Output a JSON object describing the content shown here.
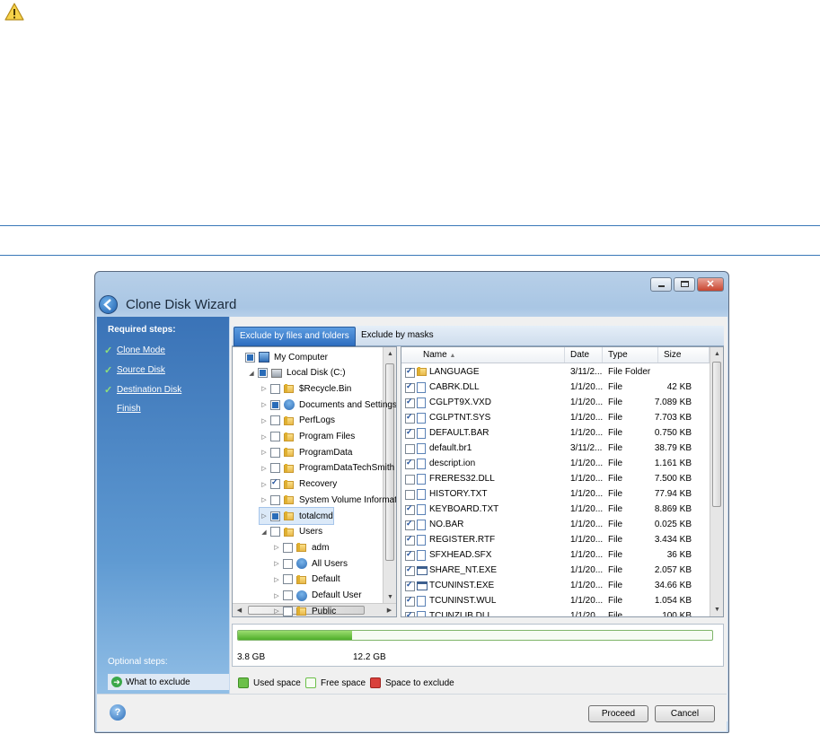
{
  "window": {
    "title": "Clone Disk Wizard",
    "controls": {
      "minimize": "minimize-icon",
      "maximize": "maximize-icon",
      "close": "close-icon"
    }
  },
  "sidebar": {
    "required_heading": "Required steps:",
    "steps": [
      {
        "label": "Clone Mode",
        "done": true
      },
      {
        "label": "Source Disk",
        "done": true
      },
      {
        "label": "Destination Disk",
        "done": true
      },
      {
        "label": "Finish",
        "done": false
      }
    ],
    "optional_heading": "Optional steps:",
    "optional_steps": [
      {
        "label": "What to exclude",
        "selected": true
      }
    ]
  },
  "tabs": [
    {
      "label": "Exclude by files and folders",
      "active": true
    },
    {
      "label": "Exclude by masks",
      "active": false
    }
  ],
  "tree": [
    {
      "label": "My Computer",
      "icon": "computer",
      "check": "part",
      "expander": ""
    },
    {
      "label": "Local Disk (C:)",
      "icon": "disk",
      "check": "part",
      "expander": "◢"
    },
    {
      "label": "$Recycle.Bin",
      "icon": "folder",
      "check": "off",
      "expander": "▷"
    },
    {
      "label": "Documents and Settings",
      "icon": "user",
      "check": "part",
      "expander": "▷"
    },
    {
      "label": "PerfLogs",
      "icon": "folder",
      "check": "off",
      "expander": "▷"
    },
    {
      "label": "Program Files",
      "icon": "folder",
      "check": "off",
      "expander": "▷"
    },
    {
      "label": "ProgramData",
      "icon": "folder",
      "check": "off",
      "expander": "▷"
    },
    {
      "label": "ProgramDataTechSmith",
      "icon": "folder",
      "check": "off",
      "expander": "▷"
    },
    {
      "label": "Recovery",
      "icon": "folder",
      "check": "on",
      "expander": "▷"
    },
    {
      "label": "System Volume Information",
      "icon": "folder",
      "check": "off",
      "expander": "▷"
    },
    {
      "label": "totalcmd",
      "icon": "folder",
      "check": "part",
      "expander": "▷",
      "selected": true
    },
    {
      "label": "Users",
      "icon": "folder",
      "check": "off",
      "expander": "◢"
    },
    {
      "label": "adm",
      "icon": "folder",
      "check": "off",
      "expander": "▷"
    },
    {
      "label": "All Users",
      "icon": "user",
      "check": "off",
      "expander": "▷"
    },
    {
      "label": "Default",
      "icon": "folder",
      "check": "off",
      "expander": "▷"
    },
    {
      "label": "Default User",
      "icon": "user",
      "check": "off",
      "expander": "▷"
    },
    {
      "label": "Public",
      "icon": "folder",
      "check": "off",
      "expander": "▷"
    }
  ],
  "list": {
    "columns": [
      "Name",
      "Date",
      "Type",
      "Size"
    ],
    "rows": [
      {
        "name": "LANGUAGE",
        "date": "3/11/2...",
        "type": "File Folder",
        "size": "",
        "checked": true,
        "icon": "folder"
      },
      {
        "name": "CABRK.DLL",
        "date": "1/1/20...",
        "type": "File",
        "size": "42 KB",
        "checked": true,
        "icon": "file"
      },
      {
        "name": "CGLPT9X.VXD",
        "date": "1/1/20...",
        "type": "File",
        "size": "7.089 KB",
        "checked": true,
        "icon": "file"
      },
      {
        "name": "CGLPTNT.SYS",
        "date": "1/1/20...",
        "type": "File",
        "size": "7.703 KB",
        "checked": true,
        "icon": "file"
      },
      {
        "name": "DEFAULT.BAR",
        "date": "1/1/20...",
        "type": "File",
        "size": "0.750 KB",
        "checked": true,
        "icon": "file"
      },
      {
        "name": "default.br1",
        "date": "3/11/2...",
        "type": "File",
        "size": "38.79 KB",
        "checked": false,
        "icon": "file"
      },
      {
        "name": "descript.ion",
        "date": "1/1/20...",
        "type": "File",
        "size": "1.161 KB",
        "checked": true,
        "icon": "file"
      },
      {
        "name": "FRERES32.DLL",
        "date": "1/1/20...",
        "type": "File",
        "size": "7.500 KB",
        "checked": false,
        "icon": "file"
      },
      {
        "name": "HISTORY.TXT",
        "date": "1/1/20...",
        "type": "File",
        "size": "77.94 KB",
        "checked": false,
        "icon": "file"
      },
      {
        "name": "KEYBOARD.TXT",
        "date": "1/1/20...",
        "type": "File",
        "size": "8.869 KB",
        "checked": true,
        "icon": "file"
      },
      {
        "name": "NO.BAR",
        "date": "1/1/20...",
        "type": "File",
        "size": "0.025 KB",
        "checked": true,
        "icon": "file"
      },
      {
        "name": "REGISTER.RTF",
        "date": "1/1/20...",
        "type": "File",
        "size": "3.434 KB",
        "checked": true,
        "icon": "file"
      },
      {
        "name": "SFXHEAD.SFX",
        "date": "1/1/20...",
        "type": "File",
        "size": "36 KB",
        "checked": true,
        "icon": "file"
      },
      {
        "name": "SHARE_NT.EXE",
        "date": "1/1/20...",
        "type": "File",
        "size": "2.057 KB",
        "checked": true,
        "icon": "exe"
      },
      {
        "name": "TCUNINST.EXE",
        "date": "1/1/20...",
        "type": "File",
        "size": "34.66 KB",
        "checked": true,
        "icon": "exe"
      },
      {
        "name": "TCUNINST.WUL",
        "date": "1/1/20...",
        "type": "File",
        "size": "1.054 KB",
        "checked": true,
        "icon": "file"
      },
      {
        "name": "TCUNZLIB.DLL",
        "date": "1/1/20...",
        "type": "File",
        "size": "100 KB",
        "checked": true,
        "icon": "file"
      }
    ]
  },
  "disk": {
    "used_label": "3.8 GB",
    "total_label": "12.2 GB",
    "used_fraction": 0.24,
    "colors": {
      "used": "#4fae2a",
      "free": "#f6fbf3",
      "exclude": "#d9413c"
    }
  },
  "legend": [
    {
      "label": "Used space",
      "color": "#6cc04a"
    },
    {
      "label": "Free space",
      "color": "#f6fbf3"
    },
    {
      "label": "Space to exclude",
      "color": "#d9413c"
    }
  ],
  "footer": {
    "proceed": "Proceed",
    "cancel": "Cancel",
    "help": "?"
  }
}
